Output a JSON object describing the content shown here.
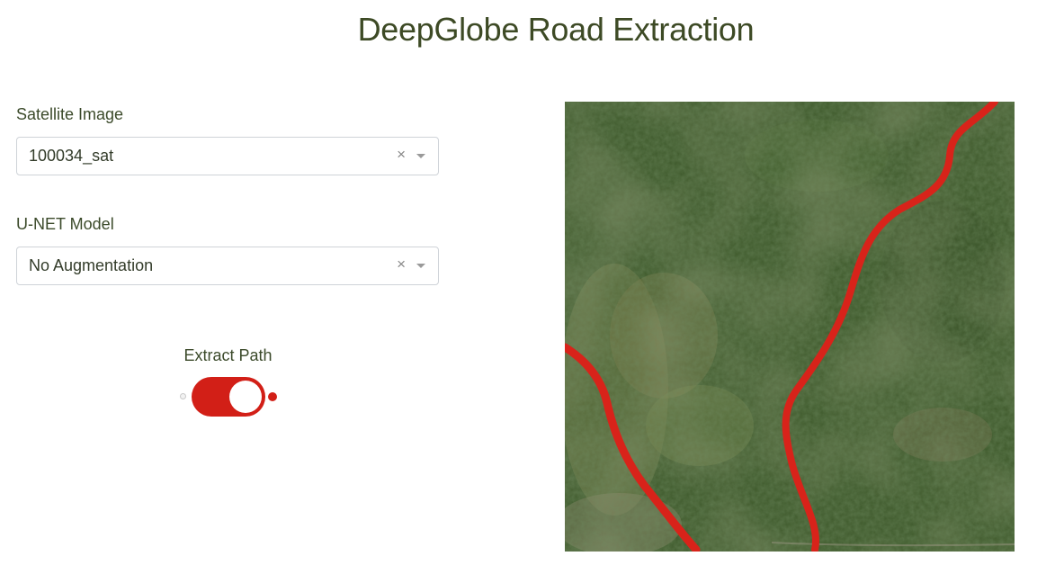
{
  "page": {
    "title": "DeepGlobe Road Extraction"
  },
  "satellite_select": {
    "label": "Satellite Image",
    "value": "100034_sat",
    "clear_glyph": "×"
  },
  "model_select": {
    "label": "U-NET Model",
    "value": "No Augmentation",
    "clear_glyph": "×"
  },
  "extract_toggle": {
    "label": "Extract Path",
    "on": true,
    "color": "#d21f17"
  },
  "output_image": {
    "description_icon": "satellite-image",
    "road_overlay_color": "#d8231a"
  },
  "colors": {
    "title_text": "#3d4a25",
    "label_text": "#3b4a2a",
    "select_border": "#cfd3d8",
    "toggle_on": "#d21f17"
  }
}
